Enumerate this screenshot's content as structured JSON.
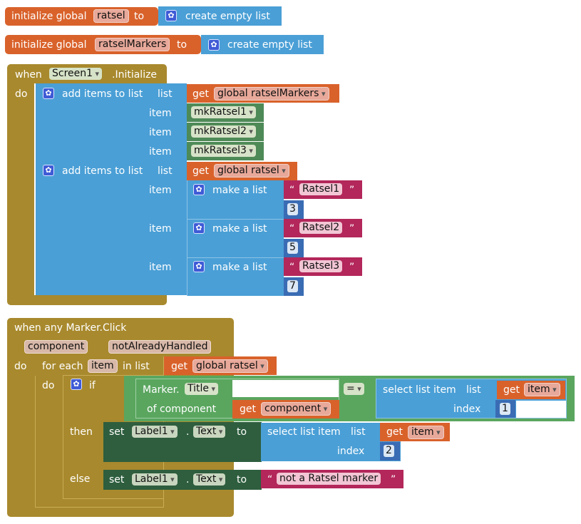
{
  "init1": {
    "prefix": "initialize global",
    "var": "ratsel",
    "to": "to",
    "action": "create empty list"
  },
  "init2": {
    "prefix": "initialize global",
    "var": "ratselMarkers",
    "to": "to",
    "action": "create empty list"
  },
  "screen_event": {
    "when": "when",
    "component": "Screen1",
    "event": ".Initialize",
    "do": "do",
    "add1": {
      "label": "add items to list",
      "list_kw": "list",
      "get": "get",
      "list_var": "global ratselMarkers",
      "item_kw": "item",
      "items": [
        "mkRatsel1",
        "mkRatsel2",
        "mkRatsel3"
      ]
    },
    "add2": {
      "label": "add items to list",
      "list_kw": "list",
      "get": "get",
      "list_var": "global ratsel",
      "item_kw": "item",
      "make_list": "make a list",
      "entries": [
        {
          "name": "Ratsel1",
          "num": "3"
        },
        {
          "name": "Ratsel2",
          "num": "5"
        },
        {
          "name": "Ratsel3",
          "num": "7"
        }
      ]
    }
  },
  "marker_event": {
    "when": "when any Marker.Click",
    "param1": "component",
    "param2": "notAlreadyHandled",
    "do": "do",
    "foreach": "for each",
    "item_var": "item",
    "in_list": "in list",
    "get": "get",
    "list_var": "global ratsel",
    "do2": "do",
    "if": "if",
    "marker": "Marker.",
    "title": "Title",
    "of_component": "of component",
    "get_component": "component",
    "eq": "=",
    "select1": {
      "label": "select list item",
      "list_kw": "list",
      "get": "get",
      "var": "item",
      "index_kw": "index",
      "index": "1"
    },
    "then": "then",
    "set": "set",
    "label_comp": "Label1",
    "dot": ".",
    "prop": "Text",
    "to": "to",
    "select2": {
      "label": "select list item",
      "list_kw": "list",
      "get": "get",
      "var": "item",
      "index_kw": "index",
      "index": "2"
    },
    "else": "else",
    "else_text": "not a Ratsel marker"
  }
}
